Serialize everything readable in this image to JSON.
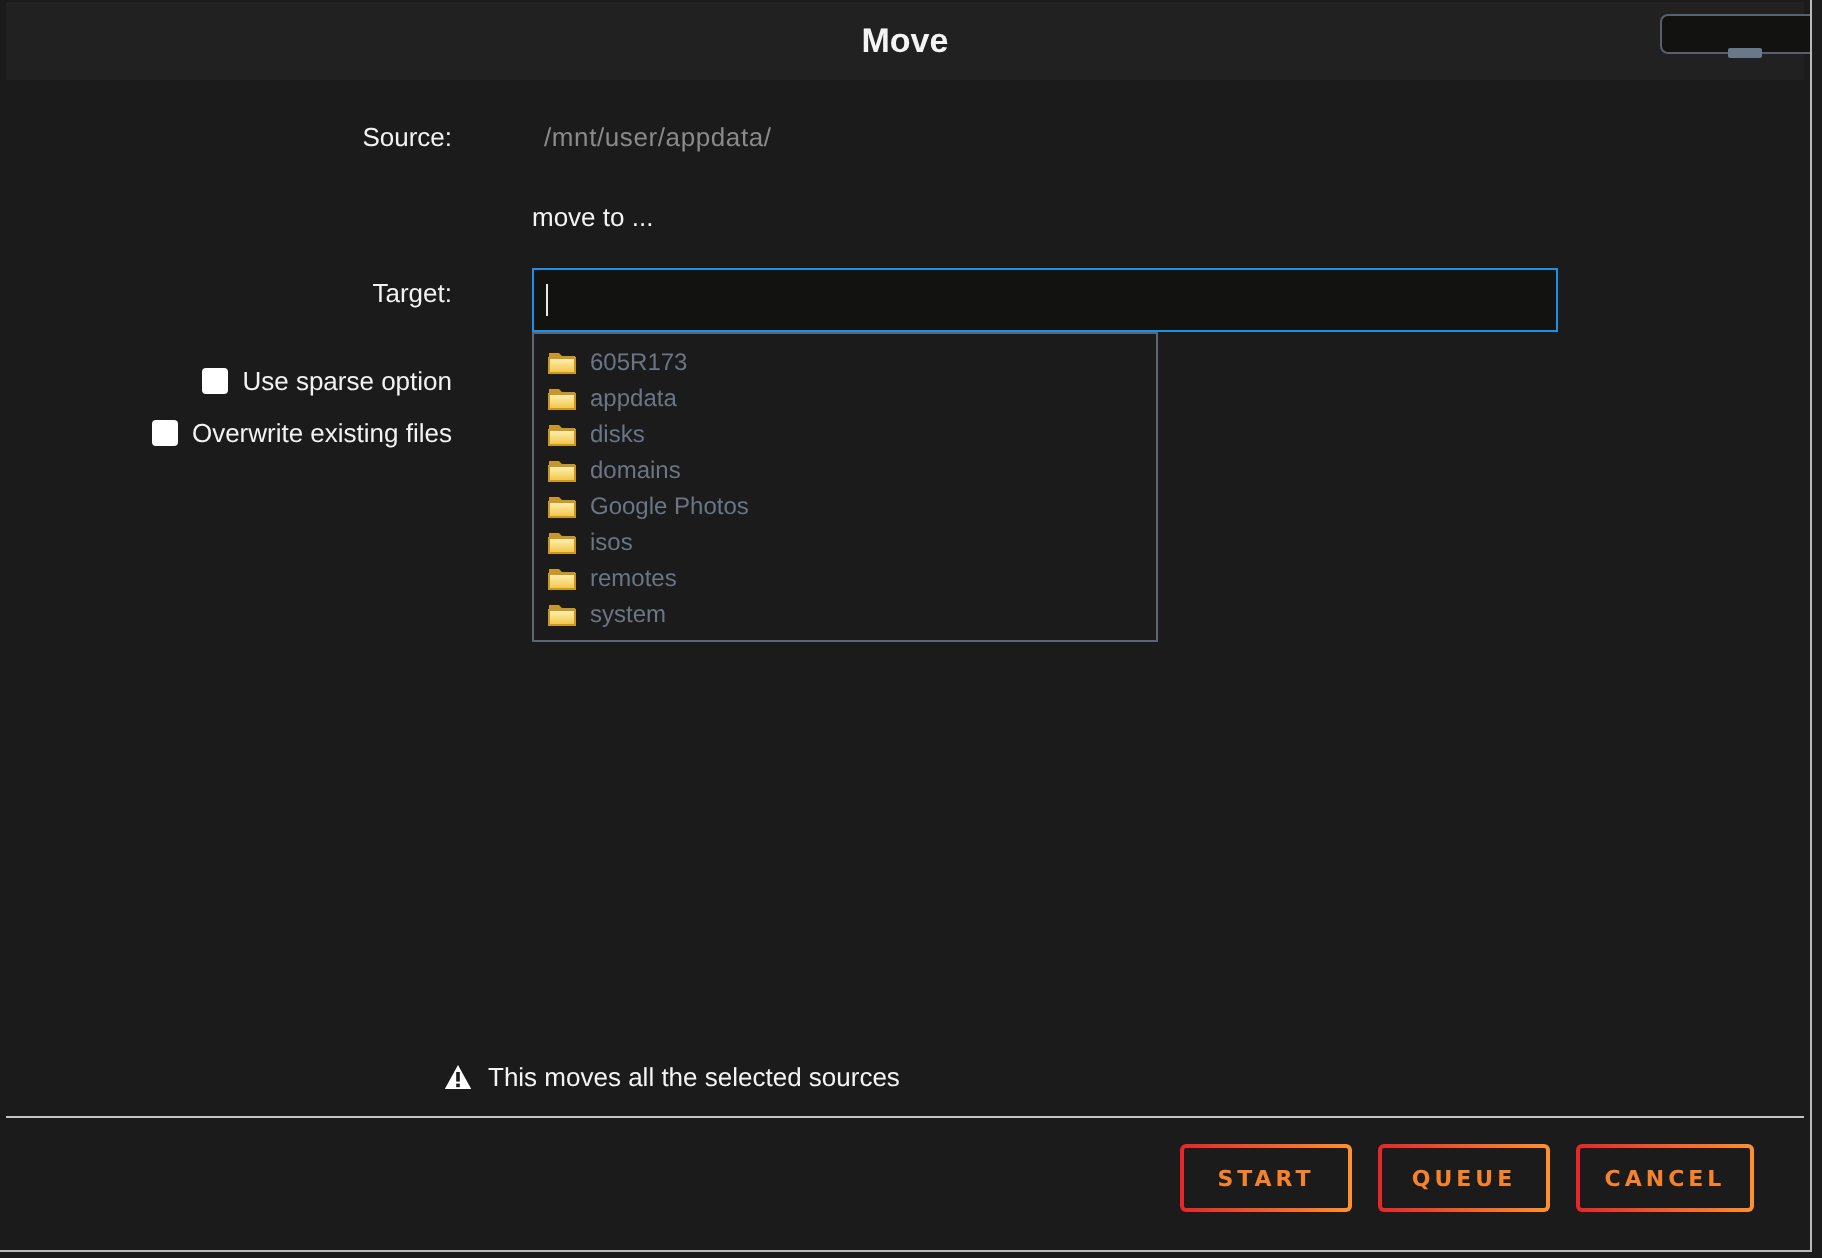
{
  "dialog": {
    "title": "Move"
  },
  "source": {
    "label": "Source:",
    "value": "/mnt/user/appdata/"
  },
  "hint": "move to ...",
  "target": {
    "label": "Target:",
    "focused": true
  },
  "folders": [
    {
      "name": "605R173"
    },
    {
      "name": "appdata"
    },
    {
      "name": "disks"
    },
    {
      "name": "domains"
    },
    {
      "name": "Google Photos"
    },
    {
      "name": "isos"
    },
    {
      "name": "remotes"
    },
    {
      "name": "system"
    }
  ],
  "options": [
    {
      "label": "Use sparse option",
      "checked": false
    },
    {
      "label": "Overwrite existing files",
      "checked": false
    }
  ],
  "warning": "This moves all the selected sources",
  "buttons": [
    {
      "label": "START"
    },
    {
      "label": "QUEUE"
    },
    {
      "label": "CANCEL"
    }
  ]
}
